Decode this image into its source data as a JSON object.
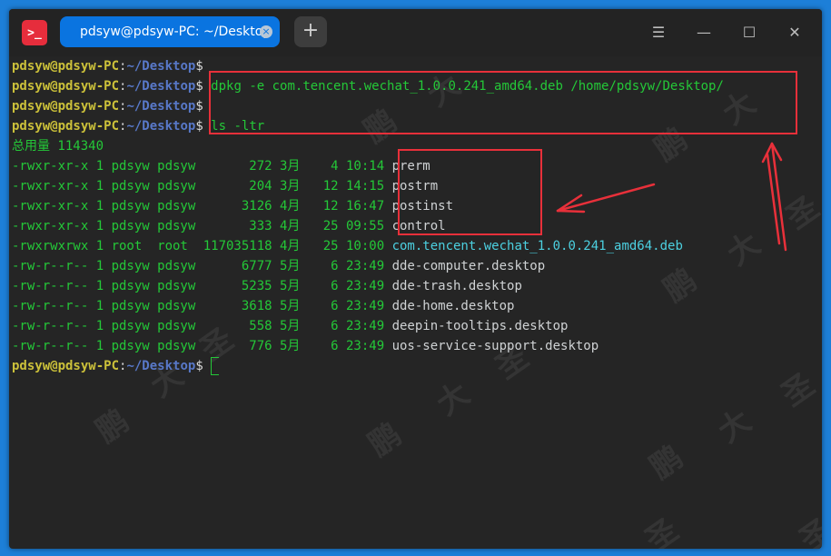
{
  "window": {
    "app_icon_glyph": ">_",
    "tab_title": "pdsyw@pdsyw-PC: ~/Desktop",
    "tab_close_glyph": "×",
    "new_tab_glyph": "+",
    "menu_glyph": "☰",
    "minimize_glyph": "—",
    "maximize_glyph": "☐",
    "close_glyph": "✕"
  },
  "terminal": {
    "user": "pdsyw@pdsyw-PC",
    "colon": ":",
    "path": "~/Desktop",
    "dollar": "$",
    "cmd1": " dpkg -e com.tencent.wechat_1.0.0.241_amd64.deb /home/pdsyw/Desktop/",
    "cmd2": " ls -ltr",
    "total": "总用量 114340",
    "listing": [
      {
        "meta": "-rwxr-xr-x 1 pdsyw pdsyw       272 3月    4 10:14 ",
        "name": "prerm"
      },
      {
        "meta": "-rwxr-xr-x 1 pdsyw pdsyw       204 3月   12 14:15 ",
        "name": "postrm"
      },
      {
        "meta": "-rwxr-xr-x 1 pdsyw pdsyw      3126 4月   12 16:47 ",
        "name": "postinst"
      },
      {
        "meta": "-rwxr-xr-x 1 pdsyw pdsyw       333 4月   25 09:55 ",
        "name": "control"
      },
      {
        "meta": "-rwxrwxrwx 1 root  root  117035118 4月   25 10:00 ",
        "name": "com.tencent.wechat_1.0.0.241_amd64.deb"
      },
      {
        "meta": "-rw-r--r-- 1 pdsyw pdsyw      6777 5月    6 23:49 ",
        "name": "dde-computer.desktop"
      },
      {
        "meta": "-rw-r--r-- 1 pdsyw pdsyw      5235 5月    6 23:49 ",
        "name": "dde-trash.desktop"
      },
      {
        "meta": "-rw-r--r-- 1 pdsyw pdsyw      3618 5月    6 23:49 ",
        "name": "dde-home.desktop"
      },
      {
        "meta": "-rw-r--r-- 1 pdsyw pdsyw       558 5月    6 23:49 ",
        "name": "deepin-tooltips.desktop"
      },
      {
        "meta": "-rw-r--r-- 1 pdsyw pdsyw       776 5月    6 23:49 ",
        "name": "uos-service-support.desktop"
      }
    ]
  },
  "watermark": [
    "鹏",
    "大",
    "圣"
  ],
  "colors": {
    "annotation": "#e8303a",
    "desktop": "#1d7fd8",
    "tab_active": "#0a74e0"
  }
}
